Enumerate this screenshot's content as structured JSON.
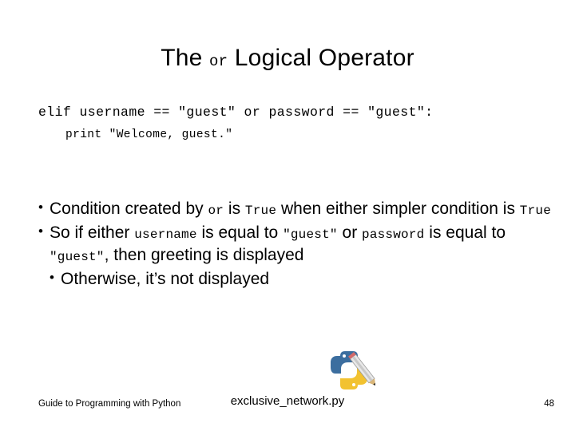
{
  "slide": {
    "title": {
      "pre": "The ",
      "keyword": "or",
      "post": " Logical Operator"
    },
    "code": {
      "line1": "elif username == \"guest\" or password == \"guest\":",
      "line2": "print \"Welcome, guest.\""
    },
    "bullets": [
      {
        "marker": "•",
        "parts": [
          {
            "text": "Condition created by ",
            "mono": false
          },
          {
            "text": "or",
            "mono": true
          },
          {
            "text": " is ",
            "mono": false
          },
          {
            "text": "True",
            "mono": true
          },
          {
            "text": " when either simpler condition is ",
            "mono": false
          },
          {
            "text": "True",
            "mono": true
          }
        ]
      },
      {
        "marker": "•",
        "parts": [
          {
            "text": "So if either ",
            "mono": false
          },
          {
            "text": "username",
            "mono": true
          },
          {
            "text": " is equal to ",
            "mono": false
          },
          {
            "text": "\"guest\"",
            "mono": true
          },
          {
            "text": " or ",
            "mono": false
          },
          {
            "text": "password",
            "mono": true
          },
          {
            "text": " is equal to ",
            "mono": false
          },
          {
            "text": "\"guest\"",
            "mono": true
          },
          {
            "text": ", then greeting is displayed",
            "mono": false
          }
        ]
      },
      {
        "marker": "•",
        "parts": [
          {
            "text": "Otherwise, it’s not displayed",
            "mono": false
          }
        ]
      }
    ],
    "footer": {
      "left": "Guide to Programming with Python",
      "center": "exclusive_network.py",
      "right": "48"
    },
    "logo": {
      "name": "python-logo-with-pencil",
      "colors": {
        "blue": "#3c6e9f",
        "yellow": "#f2c230",
        "pencil_body": "#e8e8e8",
        "pencil_tip": "#c9a227"
      }
    }
  }
}
